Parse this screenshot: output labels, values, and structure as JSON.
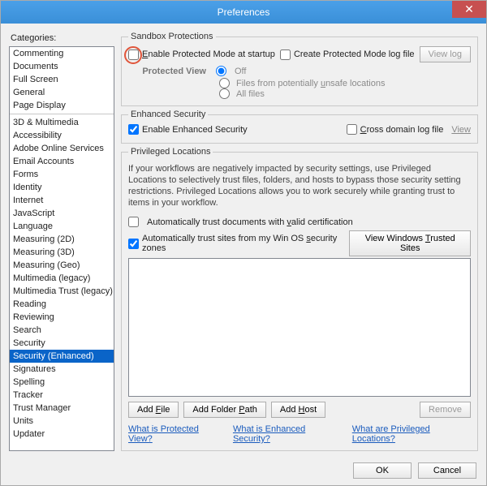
{
  "window": {
    "title": "Preferences"
  },
  "categories": {
    "label": "Categories:",
    "group1": [
      "Commenting",
      "Documents",
      "Full Screen",
      "General",
      "Page Display"
    ],
    "group2": [
      "3D & Multimedia",
      "Accessibility",
      "Adobe Online Services",
      "Email Accounts",
      "Forms",
      "Identity",
      "Internet",
      "JavaScript",
      "Language",
      "Measuring (2D)",
      "Measuring (3D)",
      "Measuring (Geo)",
      "Multimedia (legacy)",
      "Multimedia Trust (legacy)",
      "Reading",
      "Reviewing",
      "Search",
      "Security",
      "Security (Enhanced)",
      "Signatures",
      "Spelling",
      "Tracker",
      "Trust Manager",
      "Units",
      "Updater"
    ],
    "selected": "Security (Enhanced)"
  },
  "sandbox": {
    "legend": "Sandbox Protections",
    "enable_protected": "Enable Protected Mode at startup",
    "create_log": "Create Protected Mode log file",
    "view_log": "View log",
    "protected_view_label": "Protected View",
    "opt_off": "Off",
    "opt_unsafe": "Files from potentially unsafe locations",
    "opt_all": "All files"
  },
  "enhanced": {
    "legend": "Enhanced Security",
    "enable": "Enable Enhanced Security",
    "cross_log": "Cross domain log file",
    "view": "View"
  },
  "privileged": {
    "legend": "Privileged Locations",
    "desc": "If your workflows are negatively impacted by security settings, use Privileged Locations to selectively trust files, folders, and hosts to bypass those security setting restrictions. Privileged Locations allows you to work securely while granting trust to items in your workflow.",
    "trust_valid": "Automatically trust documents with valid certification",
    "trust_os": "Automatically trust sites from my Win OS security zones",
    "view_trusted": "View Windows Trusted Sites",
    "add_file": "Add File",
    "add_folder": "Add Folder Path",
    "add_host": "Add Host",
    "remove": "Remove"
  },
  "links": {
    "pv": "What is Protected View?",
    "es": "What is Enhanced Security?",
    "pl": "What are Privileged Locations?"
  },
  "buttons": {
    "ok": "OK",
    "cancel": "Cancel"
  }
}
